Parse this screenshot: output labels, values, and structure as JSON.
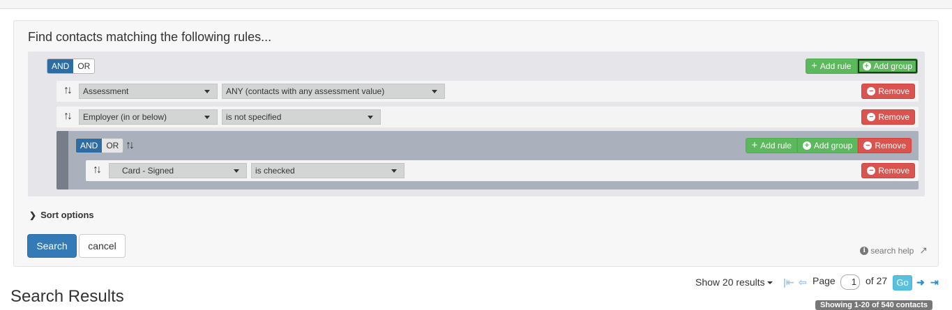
{
  "panel": {
    "title": "Find contacts matching the following rules..."
  },
  "root_group": {
    "and_label": "AND",
    "or_label": "OR",
    "selected": "AND",
    "add_rule_label": "Add rule",
    "add_group_label": "Add group",
    "rules": [
      {
        "field": "Assessment",
        "operator": "ANY (contacts with any assessment value)",
        "remove_label": "Remove"
      },
      {
        "field": "Employer (in or below)",
        "operator": "is not specified",
        "remove_label": "Remove"
      }
    ]
  },
  "nested_group": {
    "and_label": "AND",
    "or_label": "OR",
    "selected": "AND",
    "add_rule_label": "Add rule",
    "add_group_label": "Add group",
    "remove_group_label": "Remove",
    "rules": [
      {
        "field": "Card - Signed",
        "operator": "is checked",
        "remove_label": "Remove"
      }
    ]
  },
  "sort_options_label": "Sort options",
  "search_button": "Search",
  "cancel_button": "cancel",
  "search_help": "search help",
  "results": {
    "title": "Search Results",
    "show_results": "Show 20 results",
    "page_label": "Page",
    "current_page": "1",
    "of_label": "of 27",
    "go_label": "Go",
    "count_label": "Showing 1-20 of 540 contacts"
  },
  "colors": {
    "primary": "#337ab7",
    "success": "#5cb85c",
    "danger": "#d9534f",
    "info": "#5bc0de"
  }
}
